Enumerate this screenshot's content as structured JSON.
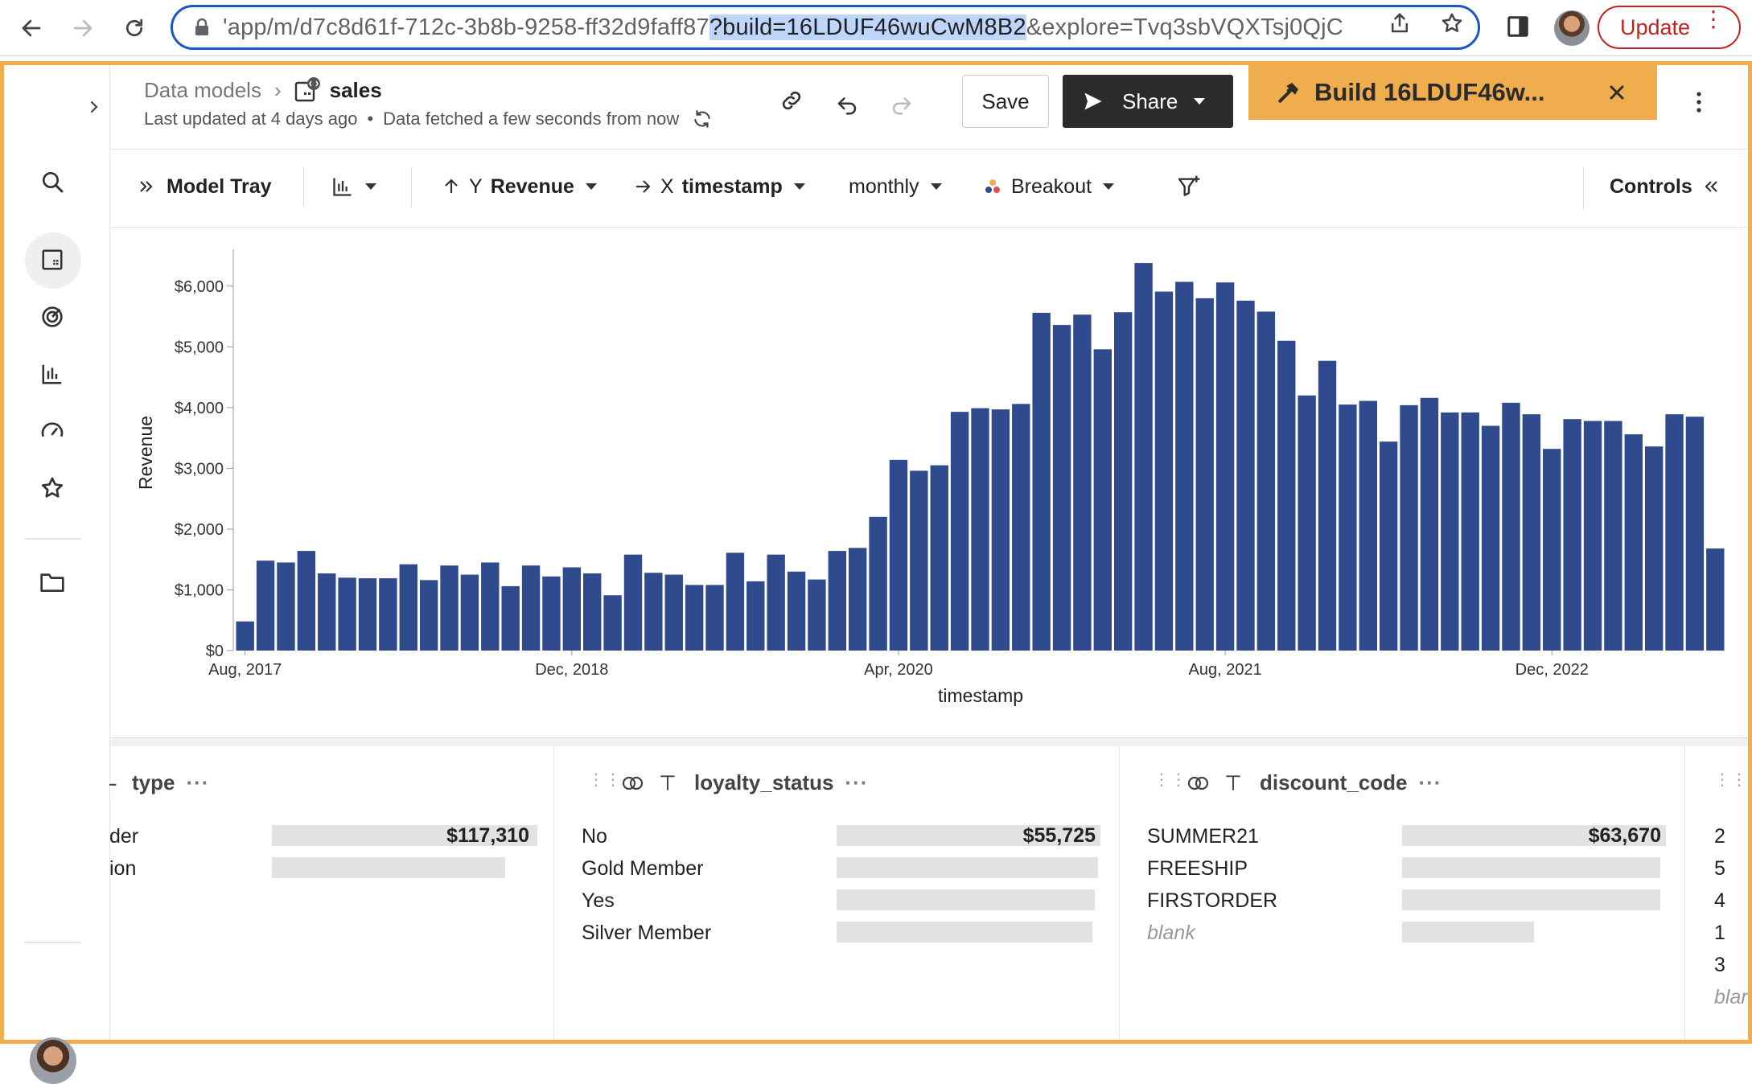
{
  "browser": {
    "url_prefix": "'app/m/d7c8d61f-712c-3b8b-9258-ff32d9faff87",
    "url_highlight": "?build=16LDUF46wuCwM8B2",
    "url_suffix": "&explore=Tvq3sbVQXTsj0QjC",
    "update_label": "Update"
  },
  "header": {
    "breadcrumb_root": "Data models",
    "model_name": "sales",
    "last_updated": "Last updated at 4 days ago",
    "data_fetched": "Data fetched a few seconds from now",
    "save_label": "Save",
    "share_label": "Share",
    "build_label": "Build 16LDUF46w..."
  },
  "toolbar": {
    "model_tray": "Model Tray",
    "y_prefix": "Y",
    "y_field": "Revenue",
    "x_prefix": "X",
    "x_field": "timestamp",
    "granularity": "monthly",
    "breakout": "Breakout",
    "controls": "Controls"
  },
  "chart_data": {
    "type": "bar",
    "xlabel": "timestamp",
    "ylabel": "Revenue",
    "ylim": [
      0,
      6500
    ],
    "yticks": [
      "$0",
      "$1,000",
      "$2,000",
      "$3,000",
      "$4,000",
      "$5,000",
      "$6,000"
    ],
    "xticks": [
      "Aug, 2017",
      "Dec, 2018",
      "Apr, 2020",
      "Aug, 2021",
      "Dec, 2022"
    ],
    "color": "#2f4a8d",
    "values": [
      480,
      1480,
      1450,
      1640,
      1270,
      1200,
      1190,
      1190,
      1420,
      1160,
      1400,
      1250,
      1450,
      1060,
      1400,
      1220,
      1370,
      1270,
      910,
      1580,
      1280,
      1250,
      1080,
      1080,
      1610,
      1140,
      1580,
      1300,
      1170,
      1640,
      1690,
      2200,
      3140,
      2960,
      3050,
      3930,
      3990,
      3970,
      4060,
      5560,
      5360,
      5530,
      4960,
      5570,
      6380,
      5910,
      6070,
      5800,
      6060,
      5760,
      5580,
      5100,
      4200,
      4770,
      4050,
      4110,
      3440,
      4040,
      4160,
      3920,
      3920,
      3700,
      4080,
      3890,
      3320,
      3810,
      3780,
      3780,
      3560,
      3360,
      3890,
      3850,
      1680
    ]
  },
  "columns": [
    {
      "name": "type",
      "more": "···",
      "rows": [
        {
          "label": "der",
          "value": "$117,310",
          "fraction": 1.0
        },
        {
          "label": "ion",
          "value": "",
          "fraction": 0.88
        }
      ]
    },
    {
      "name": "loyalty_status",
      "more": "···",
      "rows": [
        {
          "label": "No",
          "value": "$55,725",
          "fraction": 1.0
        },
        {
          "label": "Gold Member",
          "value": "",
          "fraction": 0.99
        },
        {
          "label": "Yes",
          "value": "",
          "fraction": 0.98
        },
        {
          "label": "Silver Member",
          "value": "",
          "fraction": 0.97
        }
      ]
    },
    {
      "name": "discount_code",
      "more": "···",
      "rows": [
        {
          "label": "SUMMER21",
          "value": "$63,670",
          "fraction": 1.0
        },
        {
          "label": "FREESHIP",
          "value": "",
          "fraction": 0.98
        },
        {
          "label": "FIRSTORDER",
          "value": "",
          "fraction": 0.98
        },
        {
          "label": "blank",
          "value": "",
          "fraction": 0.5
        }
      ]
    },
    {
      "name": "",
      "rows": [
        {
          "label": "2"
        },
        {
          "label": "5"
        },
        {
          "label": "4"
        },
        {
          "label": "1"
        },
        {
          "label": "3"
        },
        {
          "label": "blar"
        }
      ]
    }
  ]
}
